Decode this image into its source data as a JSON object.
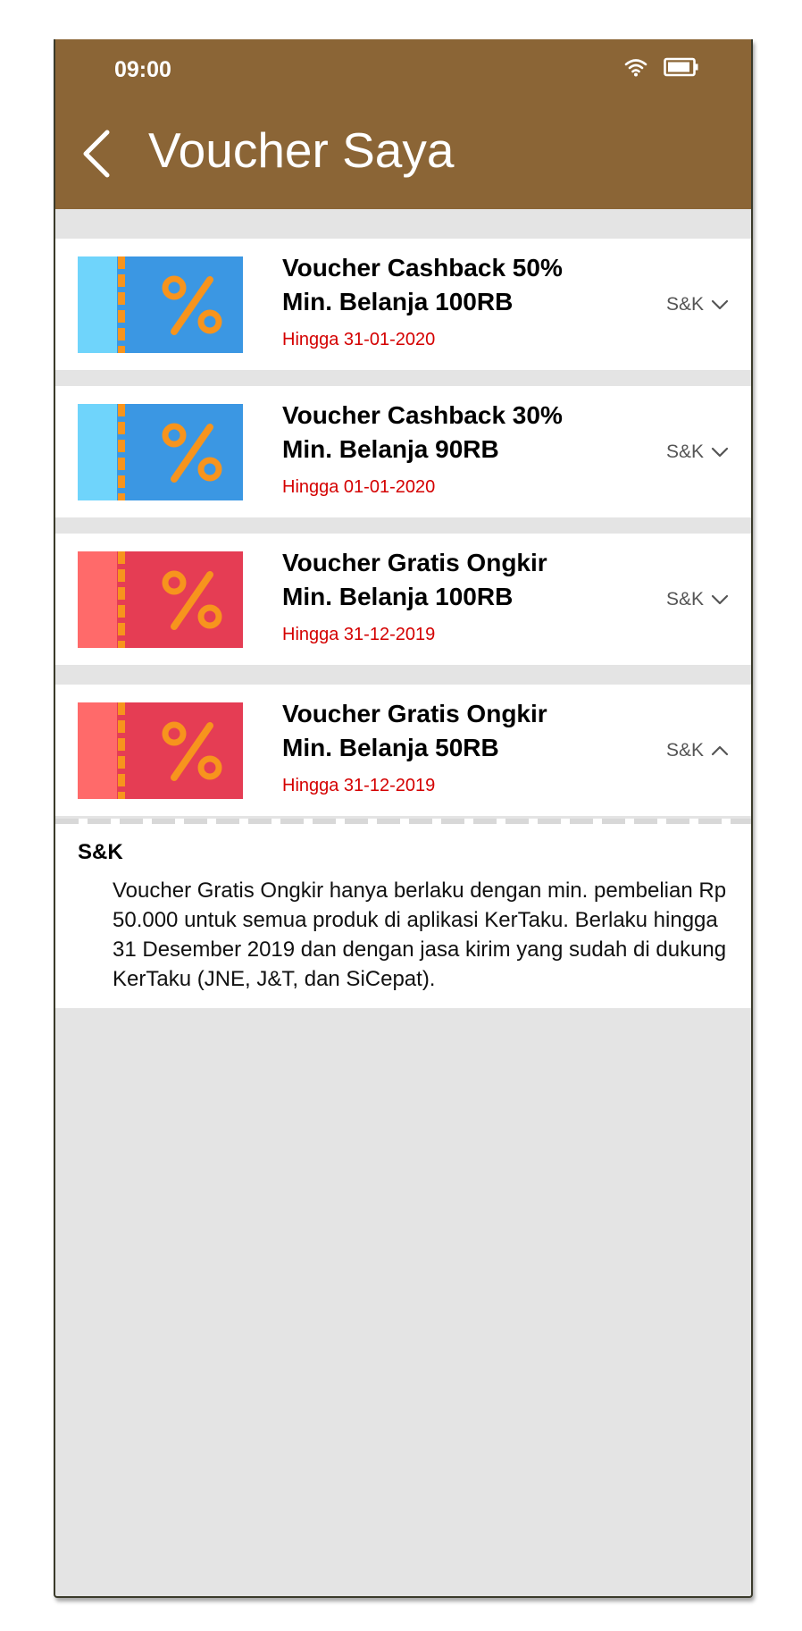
{
  "status_bar": {
    "time": "09:00",
    "icons": [
      "wifi-icon",
      "battery-icon"
    ]
  },
  "header": {
    "title": "Voucher Saya",
    "back_icon": "chevron-left-icon"
  },
  "colors": {
    "header": "#8b6536",
    "blue_ticket": "#3b97e3",
    "red_ticket": "#e53d54",
    "expiry": "#d40000"
  },
  "vouchers": [
    {
      "name": "Voucher Cashback 50%\nMin. Belanja 100RB",
      "expiry": "Hingga 31-01-2020",
      "sk_label": "S&K",
      "style": "blue",
      "expanded": false
    },
    {
      "name": "Voucher Cashback 30%\nMin. Belanja 90RB",
      "expiry": "Hingga 01-01-2020",
      "sk_label": "S&K",
      "style": "blue",
      "expanded": false
    },
    {
      "name": "Voucher Gratis Ongkir\nMin. Belanja 100RB",
      "expiry": "Hingga 31-12-2019",
      "sk_label": "S&K",
      "style": "red",
      "expanded": false
    },
    {
      "name": "Voucher Gratis Ongkir\nMin. Belanja 50RB",
      "expiry": "Hingga 31-12-2019",
      "sk_label": "S&K",
      "style": "red",
      "expanded": true
    }
  ],
  "terms": {
    "title": "S&K",
    "body": "Voucher Gratis Ongkir hanya berlaku dengan min. pembelian Rp 50.000 untuk semua produk di aplikasi KerTaku. Berlaku hingga 31 Desember 2019 dan dengan jasa kirim yang sudah di dukung KerTaku (JNE, J&T, dan SiCepat)."
  }
}
